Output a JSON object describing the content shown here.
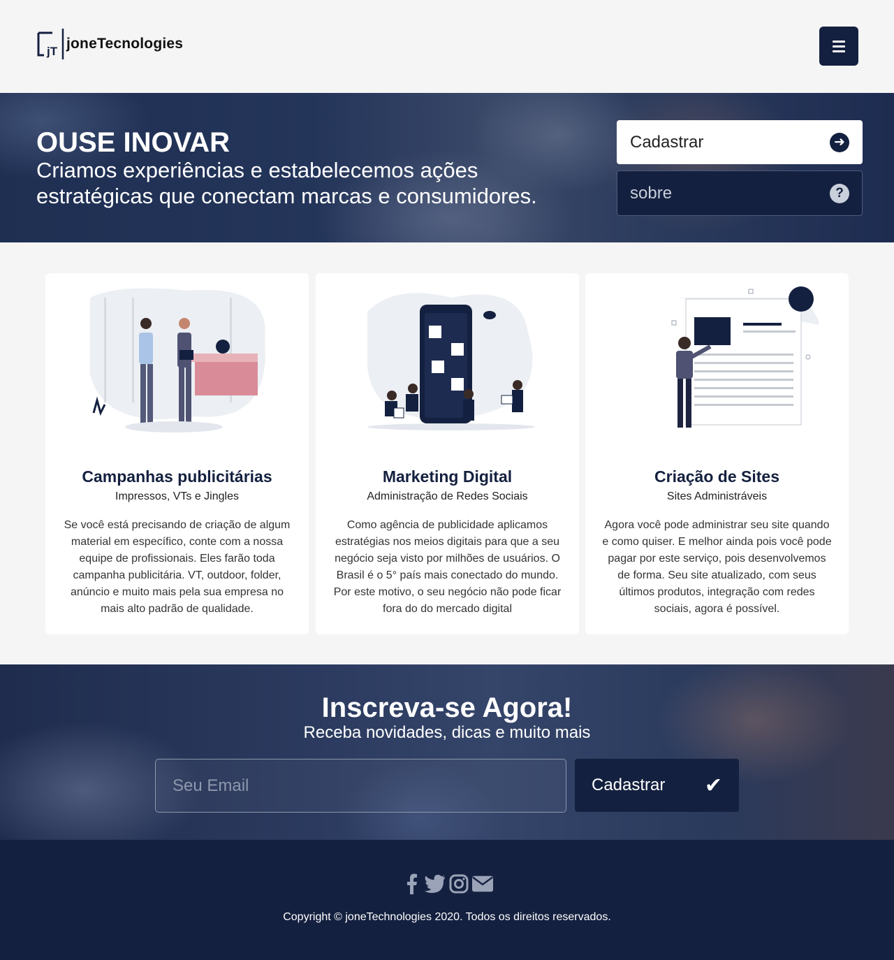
{
  "brand": {
    "name": "joneTecnologies",
    "logo_letters": "jT"
  },
  "header": {
    "menu_icon": "hamburger-icon"
  },
  "hero": {
    "title": "OUSE INOVAR",
    "subtitle": "Criamos experiências e estabelecemos ações estratégicas que conectam marcas e consumidores.",
    "buttons": [
      {
        "label": "Cadastrar",
        "icon": "arrow-right-circle-icon"
      },
      {
        "label": "sobre",
        "icon": "question-circle-icon"
      }
    ]
  },
  "services": [
    {
      "title": "Campanhas publicitárias",
      "subtitle": "Impressos, VTs e Jingles",
      "text": "Se você está precisando de criação de algum material em específico, conte com a nossa equipe de profissionais. Eles farão toda campanha publicitária. VT, outdoor, folder, anúncio e muito mais pela sua empresa no mais alto padrão de qualidade."
    },
    {
      "title": "Marketing Digital",
      "subtitle": "Administração de Redes Sociais",
      "text": "Como agência de publicidade aplicamos estratégias nos meios digitais para que a seu negócio seja visto por milhões de usuários. O Brasil é o 5° país mais conectado do mundo. Por este motivo, o seu negócio não pode ficar fora do do mercado digital"
    },
    {
      "title": "Criação de Sites",
      "subtitle": "Sites Administráveis",
      "text": "Agora você pode administrar seu site quando e como quiser. E melhor ainda pois você pode pagar por este serviço, pois desenvolvemos de forma. Seu site atualizado, com seus últimos produtos, integração com redes sociais, agora é possível."
    }
  ],
  "subscribe": {
    "title": "Inscreva-se Agora!",
    "subtitle": "Receba novidades, dicas e muito mais",
    "email_placeholder": "Seu Email",
    "button_label": "Cadastrar",
    "button_icon": "check-icon"
  },
  "footer": {
    "social_icons": [
      "facebook-icon",
      "twitter-icon",
      "instagram-icon",
      "envelope-icon"
    ],
    "copyright": "Copyright © joneTechnologies 2020. Todos os direitos reservados."
  },
  "colors": {
    "primary": "#14203f",
    "background": "#f5f5f5",
    "card": "#ffffff",
    "accent_pink": "#d98c98"
  }
}
